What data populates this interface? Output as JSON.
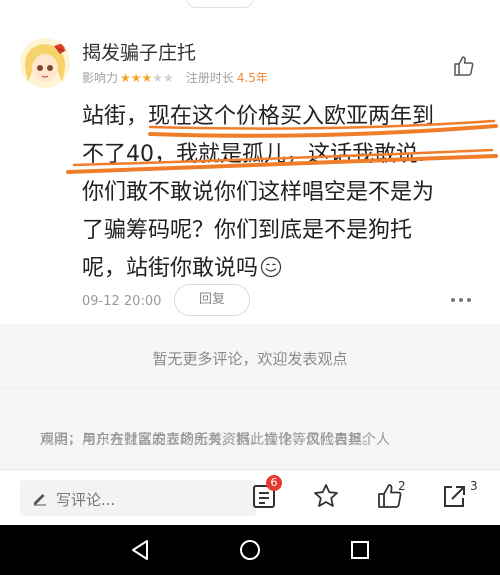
{
  "comment": {
    "username": "揭发骗子庄托",
    "influence_label": "影响力",
    "stars": {
      "filled": 3,
      "total": 5
    },
    "register_label": "注册时长",
    "register_value": "4.5年",
    "text_lines": [
      "站街，现在这个价格买入欧亚两年到",
      "不了40，我就是孤儿，这话我敢说.",
      "你们敢不敢说你们这样唱空是不是为",
      "了骗筹码呢？你们到底是不是狗托",
      "呢，站街你敢说吗"
    ],
    "time": "09-12 20:00",
    "reply_label": "回复"
  },
  "no_more_text": "暂无更多评论，欢迎发表观点",
  "disclaimer_lines": [
    "声明：用户在社区发表的所有资料、言论等仅代表其个人",
    "观点，与东方财富的立场无关。据此操作，风险自担。"
  ],
  "bottom_bar": {
    "placeholder": "写评论...",
    "comments_badge": "6",
    "like_count": "2",
    "share_count": "3"
  },
  "colors": {
    "star": "#f5a623",
    "register_value": "#f08a3c",
    "badge": "#e53a2f",
    "scribble": "#f07d2a"
  }
}
